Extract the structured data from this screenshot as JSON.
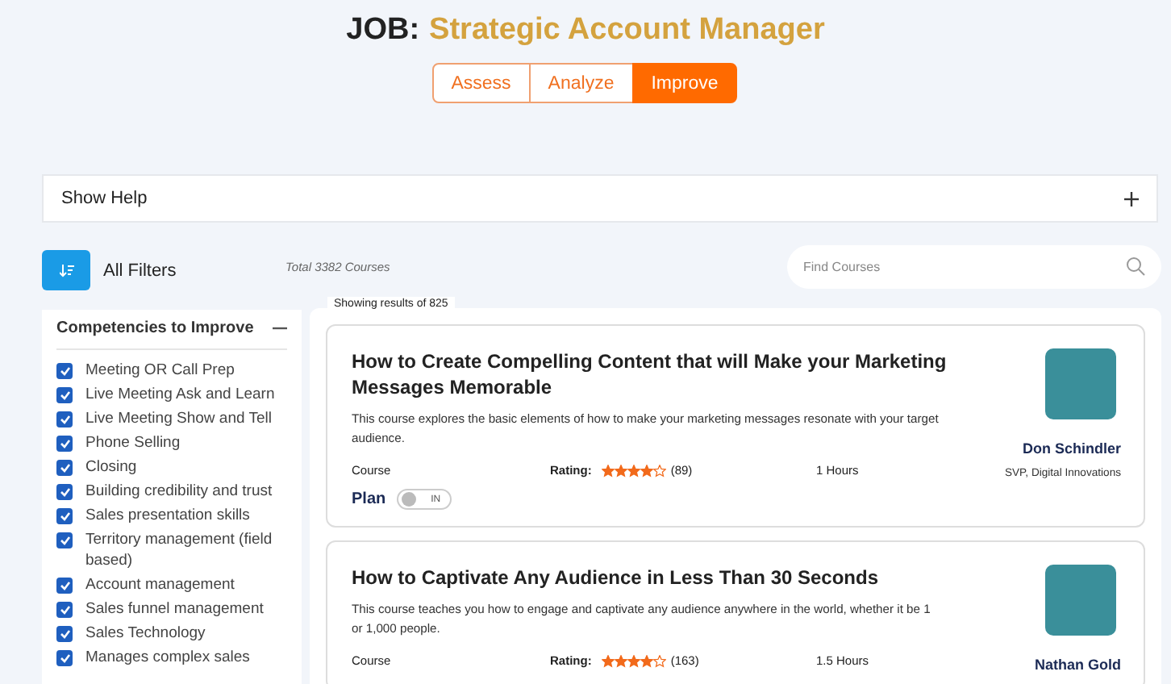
{
  "header": {
    "prefix": "JOB:",
    "title": "Strategic Account Manager"
  },
  "tabs": [
    {
      "label": "Assess",
      "selected": false
    },
    {
      "label": "Analyze",
      "selected": false
    },
    {
      "label": "Improve",
      "selected": true
    }
  ],
  "help": {
    "label": "Show Help",
    "expanded": false
  },
  "filters": {
    "label": "All Filters"
  },
  "total": "Total 3382 Courses",
  "search": {
    "placeholder": "Find Courses"
  },
  "sidebar": {
    "title": "Competencies to Improve",
    "expanded": true,
    "items": [
      {
        "label": "Meeting OR Call Prep",
        "checked": true
      },
      {
        "label": "Live Meeting Ask and Learn",
        "checked": true
      },
      {
        "label": "Live Meeting Show and Tell",
        "checked": true
      },
      {
        "label": "Phone Selling",
        "checked": true
      },
      {
        "label": "Closing",
        "checked": true
      },
      {
        "label": "Building credibility and trust",
        "checked": true
      },
      {
        "label": "Sales presentation skills",
        "checked": true
      },
      {
        "label": "Territory management (field based)",
        "checked": true
      },
      {
        "label": "Account management",
        "checked": true
      },
      {
        "label": "Sales funnel management",
        "checked": true
      },
      {
        "label": "Sales Technology",
        "checked": true
      },
      {
        "label": "Manages complex sales",
        "checked": true
      }
    ]
  },
  "results": {
    "label": "Showing results of 825",
    "courses": [
      {
        "title": "How to Create Compelling Content that will Make your Marketing Messages Memorable",
        "description": "This course explores the basic elements of how to make your marketing messages resonate with your target audience.",
        "type": "Course",
        "rating_label": "Rating:",
        "stars": 4,
        "count": "(89)",
        "duration": "1 Hours",
        "author": "Don Schindler",
        "role": "SVP, Digital Innovations",
        "plan": {
          "label": "Plan",
          "toggle_text": "IN",
          "on": false
        }
      },
      {
        "title": "How to Captivate Any Audience in Less Than 30 Seconds",
        "description": "This course teaches you how to engage and captivate any audience anywhere in the world, whether it be 1 or 1,000 people.",
        "type": "Course",
        "rating_label": "Rating:",
        "stars": 4,
        "count": "(163)",
        "duration": "1.5 Hours",
        "author": "Nathan Gold"
      }
    ]
  }
}
